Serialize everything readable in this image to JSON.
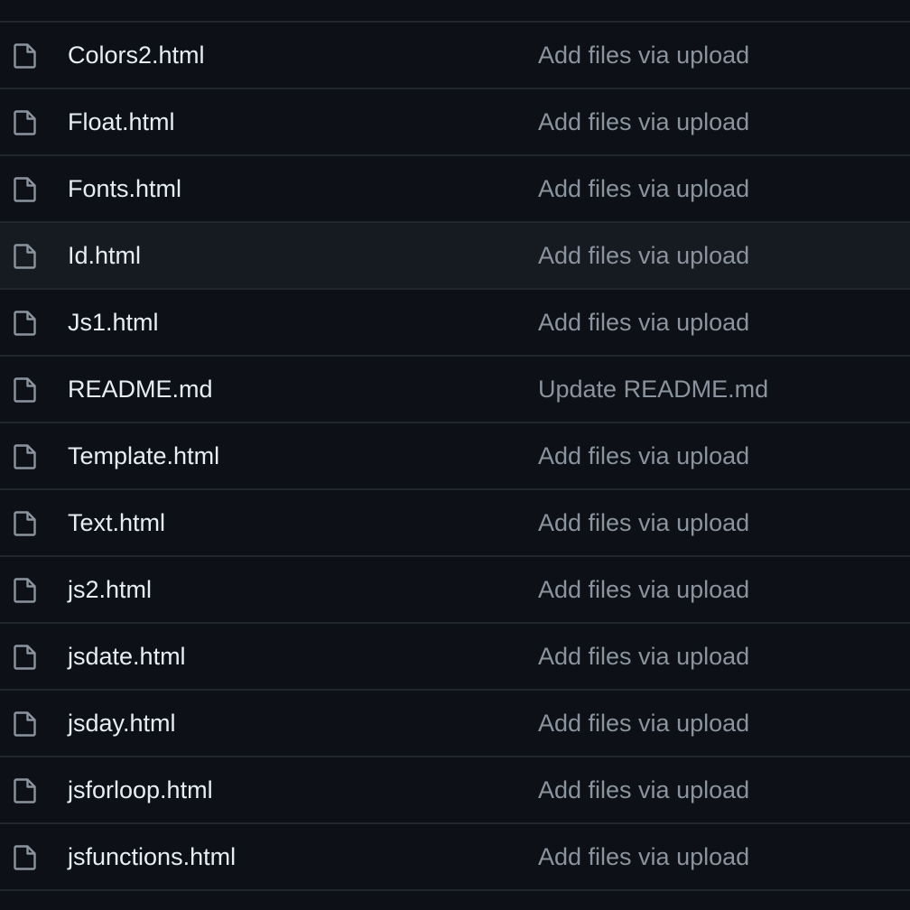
{
  "colors": {
    "background": "#0d1117",
    "row_hover": "#161b22",
    "divider": "#21262d",
    "file_name": "#e6edf3",
    "commit_message": "#8b949e",
    "icon": "#8b949e"
  },
  "files": [
    {
      "name": "Colors2.html",
      "icon": "file-icon",
      "commit": "Add files via upload"
    },
    {
      "name": "Float.html",
      "icon": "file-icon",
      "commit": "Add files via upload"
    },
    {
      "name": "Fonts.html",
      "icon": "file-icon",
      "commit": "Add files via upload"
    },
    {
      "name": "Id.html",
      "icon": "file-icon",
      "commit": "Add files via upload",
      "hovered": true
    },
    {
      "name": "Js1.html",
      "icon": "file-icon",
      "commit": "Add files via upload"
    },
    {
      "name": "README.md",
      "icon": "file-icon",
      "commit": "Update README.md"
    },
    {
      "name": "Template.html",
      "icon": "file-icon",
      "commit": "Add files via upload"
    },
    {
      "name": "Text.html",
      "icon": "file-icon",
      "commit": "Add files via upload"
    },
    {
      "name": "js2.html",
      "icon": "file-icon",
      "commit": "Add files via upload"
    },
    {
      "name": "jsdate.html",
      "icon": "file-icon",
      "commit": "Add files via upload"
    },
    {
      "name": "jsday.html",
      "icon": "file-icon",
      "commit": "Add files via upload"
    },
    {
      "name": "jsforloop.html",
      "icon": "file-icon",
      "commit": "Add files via upload"
    },
    {
      "name": "jsfunctions.html",
      "icon": "file-icon",
      "commit": "Add files via upload"
    }
  ]
}
